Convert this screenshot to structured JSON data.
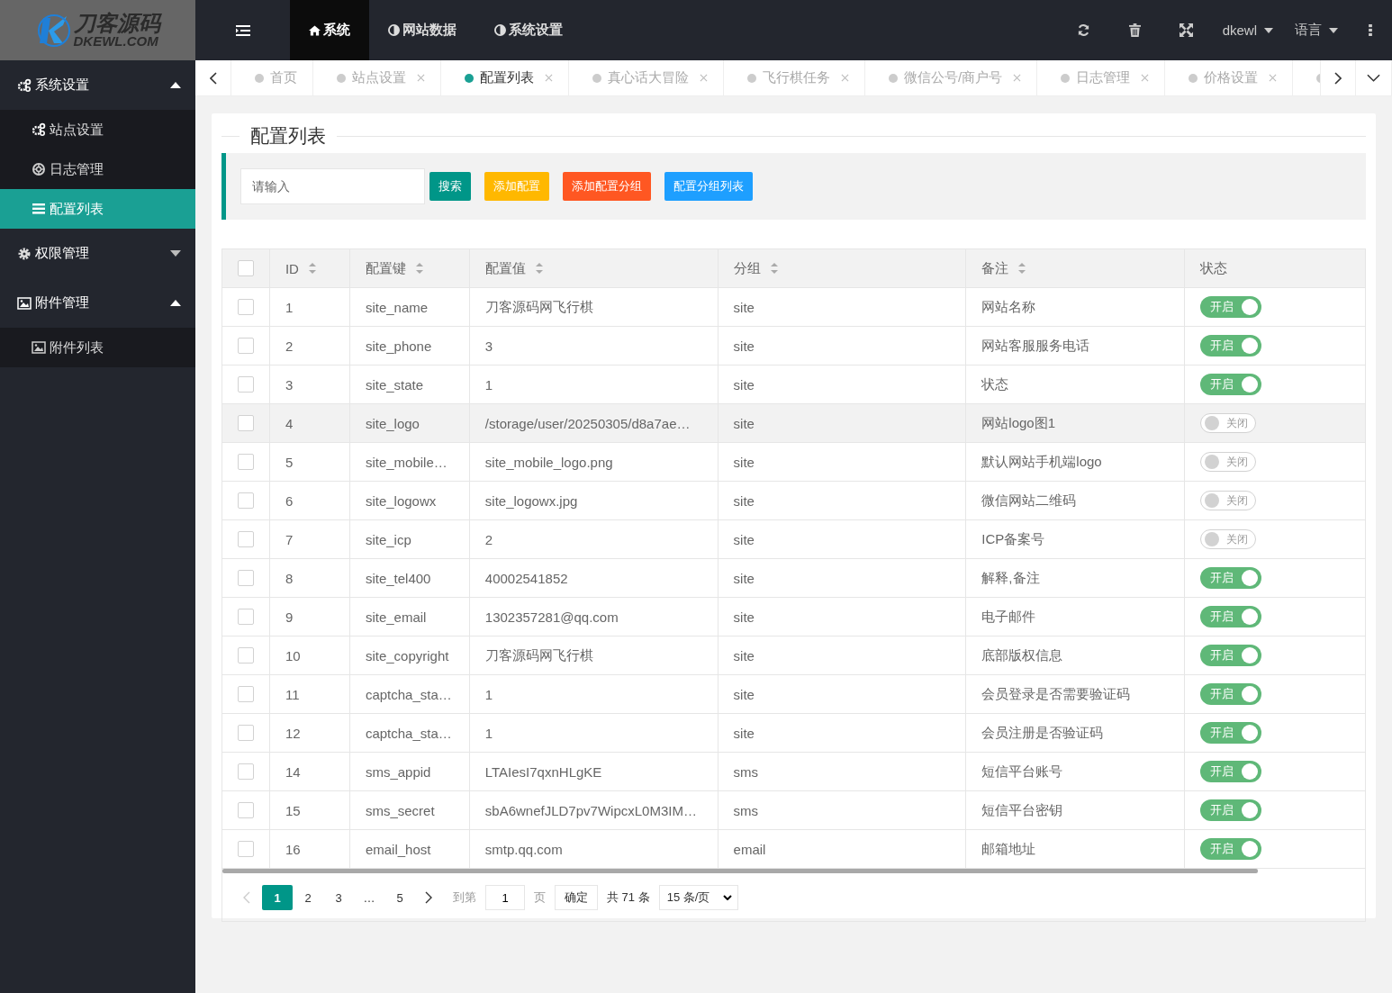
{
  "logo": {
    "title": "刀客源码",
    "subtitle": "DKEWL.COM"
  },
  "top_nav": {
    "items": [
      {
        "label": "系统",
        "selected": true
      },
      {
        "label": "网站数据",
        "selected": false
      },
      {
        "label": "系统设置",
        "selected": false
      }
    ],
    "user": "dkewl",
    "language": "语言"
  },
  "sidebar": {
    "items": [
      {
        "label": "系统设置",
        "expanded": true,
        "selected": false,
        "children": [
          {
            "label": "站点设置",
            "selected": false
          },
          {
            "label": "日志管理",
            "selected": false
          },
          {
            "label": "配置列表",
            "selected": true
          }
        ]
      },
      {
        "label": "权限管理",
        "expanded": false,
        "selected": false
      },
      {
        "label": "附件管理",
        "expanded": true,
        "selected": false,
        "children": [
          {
            "label": "附件列表",
            "selected": false
          }
        ]
      }
    ]
  },
  "page_tabs": [
    {
      "label": "首页",
      "selected": false,
      "closable": false
    },
    {
      "label": "站点设置",
      "selected": false,
      "closable": true
    },
    {
      "label": "配置列表",
      "selected": true,
      "closable": true
    },
    {
      "label": "真心话大冒险",
      "selected": false,
      "closable": true
    },
    {
      "label": "飞行棋任务",
      "selected": false,
      "closable": true
    },
    {
      "label": "微信公号/商户号",
      "selected": false,
      "closable": true
    },
    {
      "label": "日志管理",
      "selected": false,
      "closable": true
    },
    {
      "label": "价格设置",
      "selected": false,
      "closable": true
    },
    {
      "selected": false,
      "closable": false
    }
  ],
  "panel": {
    "title": "配置列表"
  },
  "toolbar": {
    "search": {
      "placeholder": "请输入"
    },
    "buttons": [
      {
        "label": "搜索",
        "color": "#009688"
      },
      {
        "label": "添加配置",
        "color": "#ffb800"
      },
      {
        "label": "添加配置分组",
        "color": "#ff5722"
      },
      {
        "label": "配置分组列表",
        "color": "#1e9fff"
      }
    ]
  },
  "table": {
    "columns": [
      {
        "label": "ID",
        "sortable": true
      },
      {
        "label": "配置键",
        "sortable": true
      },
      {
        "label": "配置值",
        "sortable": true
      },
      {
        "label": "分组",
        "sortable": true
      },
      {
        "label": "备注",
        "sortable": true
      },
      {
        "label": "状态",
        "sortable": false
      }
    ],
    "header_checked": false,
    "rows": [
      {
        "id": "1",
        "key": "site_name",
        "value": "刀客源码网飞行棋",
        "group": "site",
        "note": "网站名称",
        "on": true,
        "status": "开启",
        "checked": false,
        "highlighted": false
      },
      {
        "id": "2",
        "key": "site_phone",
        "value": "3",
        "group": "site",
        "note": "网站客服服务电话",
        "on": true,
        "status": "开启",
        "checked": false,
        "highlighted": false
      },
      {
        "id": "3",
        "key": "site_state",
        "value": "1",
        "group": "site",
        "note": "状态",
        "on": true,
        "status": "开启",
        "checked": false,
        "highlighted": false
      },
      {
        "id": "4",
        "key": "site_logo",
        "value": "/storage/user/20250305/d8a7ae…",
        "group": "site",
        "note": "网站logo图1",
        "on": false,
        "status": "关闭",
        "checked": false,
        "highlighted": true
      },
      {
        "id": "5",
        "key": "site_mobile…",
        "value": "site_mobile_logo.png",
        "group": "site",
        "note": "默认网站手机端logo",
        "on": false,
        "status": "关闭",
        "checked": false,
        "highlighted": false
      },
      {
        "id": "6",
        "key": "site_logowx",
        "value": "site_logowx.jpg",
        "group": "site",
        "note": "微信网站二维码",
        "on": false,
        "status": "关闭",
        "checked": false,
        "highlighted": false
      },
      {
        "id": "7",
        "key": "site_icp",
        "value": "2",
        "group": "site",
        "note": "ICP备案号",
        "on": false,
        "status": "关闭",
        "checked": false,
        "highlighted": false
      },
      {
        "id": "8",
        "key": "site_tel400",
        "value": "40002541852",
        "group": "site",
        "note": "解释,备注",
        "on": true,
        "status": "开启",
        "checked": false,
        "highlighted": false
      },
      {
        "id": "9",
        "key": "site_email",
        "value": "1302357281@qq.com",
        "group": "site",
        "note": "电子邮件",
        "on": true,
        "status": "开启",
        "checked": false,
        "highlighted": false
      },
      {
        "id": "10",
        "key": "site_copyright",
        "value": "刀客源码网飞行棋",
        "group": "site",
        "note": "底部版权信息",
        "on": true,
        "status": "开启",
        "checked": false,
        "highlighted": false
      },
      {
        "id": "11",
        "key": "captcha_sta…",
        "value": "1",
        "group": "site",
        "note": "会员登录是否需要验证码",
        "on": true,
        "status": "开启",
        "checked": false,
        "highlighted": false
      },
      {
        "id": "12",
        "key": "captcha_sta…",
        "value": "1",
        "group": "site",
        "note": "会员注册是否验证码",
        "on": true,
        "status": "开启",
        "checked": false,
        "highlighted": false
      },
      {
        "id": "14",
        "key": "sms_appid",
        "value": "LTAIesI7qxnHLgKE",
        "group": "sms",
        "note": "短信平台账号",
        "on": true,
        "status": "开启",
        "checked": false,
        "highlighted": false
      },
      {
        "id": "15",
        "key": "sms_secret",
        "value": "sbA6wnefJLD7pv7WipcxL0M3IM…",
        "group": "sms",
        "note": "短信平台密钥",
        "on": true,
        "status": "开启",
        "checked": false,
        "highlighted": false
      },
      {
        "id": "16",
        "key": "email_host",
        "value": "smtp.qq.com",
        "group": "email",
        "note": "邮箱地址",
        "on": true,
        "status": "开启",
        "checked": false,
        "highlighted": false
      }
    ]
  },
  "pagination": {
    "pages": [
      {
        "label": "1",
        "selected": true
      },
      {
        "label": "2",
        "selected": false
      },
      {
        "label": "3",
        "selected": false
      },
      {
        "label": "…",
        "selected": false
      },
      {
        "label": "5",
        "selected": false
      }
    ],
    "goto_label": "到第",
    "goto_value": "1",
    "page_unit": "页",
    "confirm": "确定",
    "total": "共 71 条",
    "page_size": "15 条/页"
  }
}
